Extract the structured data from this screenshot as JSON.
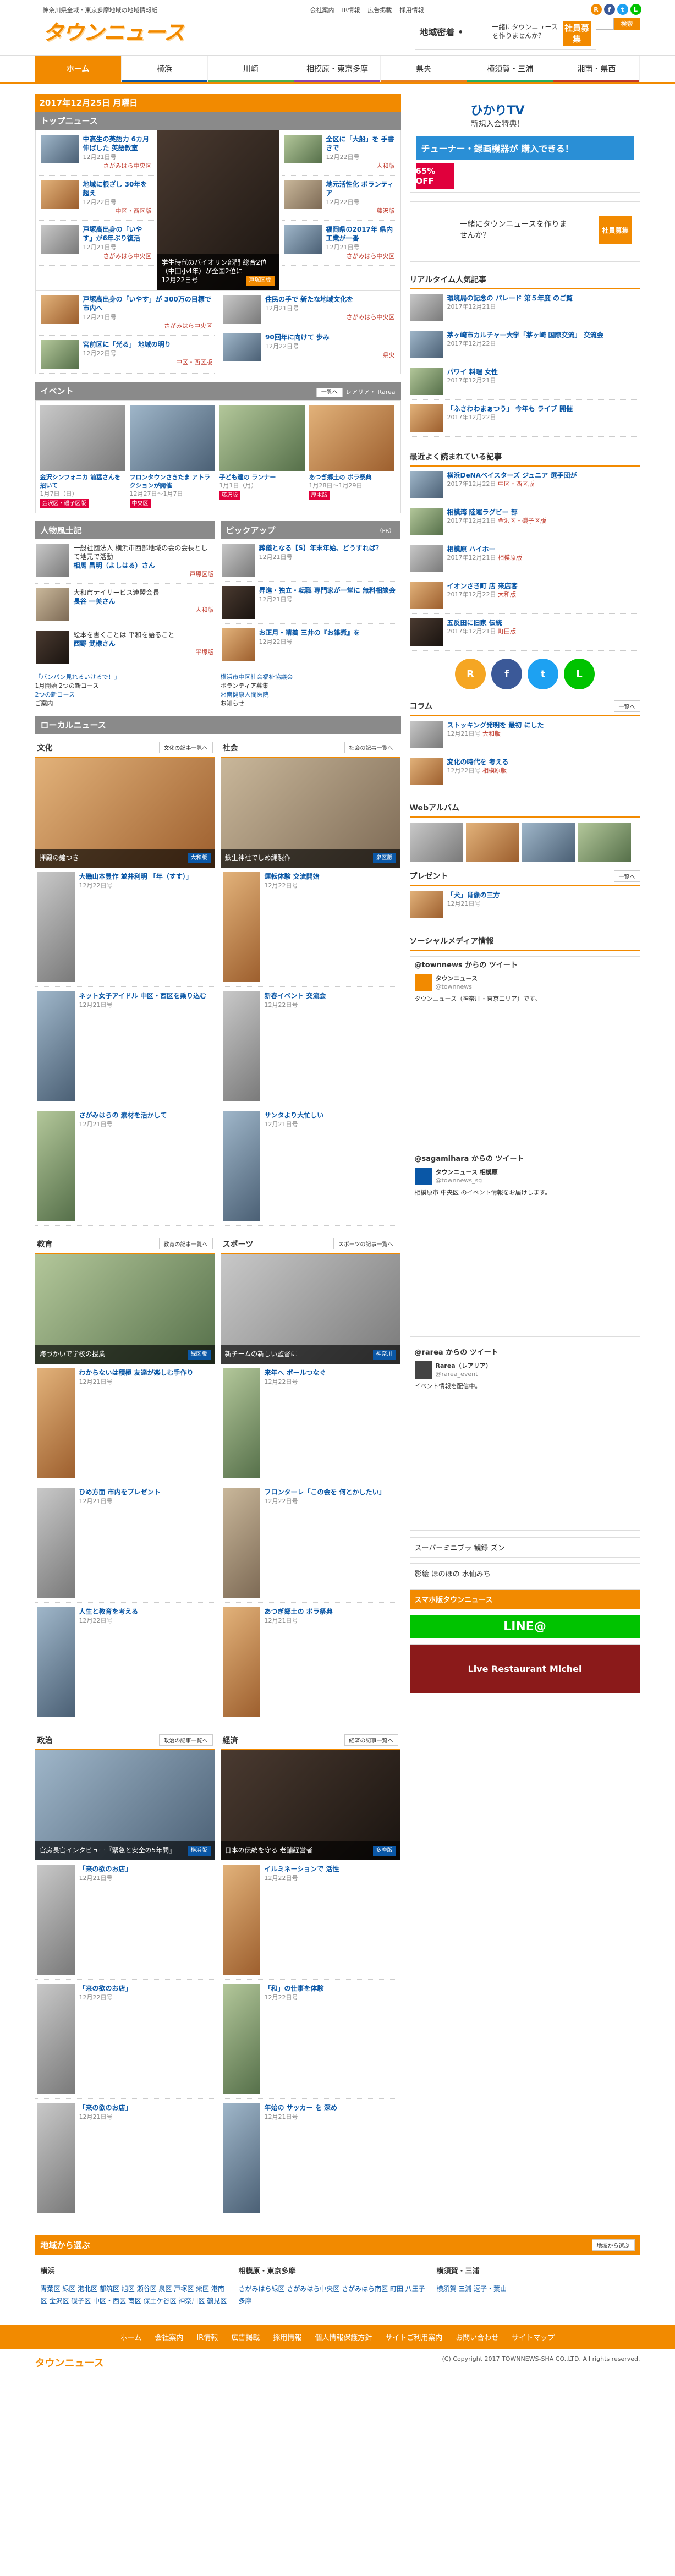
{
  "header": {
    "tagline": "神奈川県全域・東京多摩地域の地域情報紙",
    "logo": "タウンニュース",
    "logo_sub": "タウンニュース",
    "links": [
      "会社案内",
      "IR情報",
      "広告掲載",
      "採用情報"
    ],
    "search_placeholder": "",
    "search_button": "検索",
    "banner_left": "地域密着 •",
    "banner_mid": "一緒にタウンニュースを作りませんか？",
    "banner_right": "社員募集"
  },
  "nav": {
    "items": [
      {
        "label": "ホーム",
        "color": "#f28a00"
      },
      {
        "label": "横浜",
        "color": "#0a57a6"
      },
      {
        "label": "川崎",
        "color": "#4caf50"
      },
      {
        "label": "相模原・東京多摩",
        "color": "#8e44ad"
      },
      {
        "label": "県央",
        "color": "#e67e22"
      },
      {
        "label": "横須賀・三浦",
        "color": "#27ae60"
      },
      {
        "label": "湘南・県西",
        "color": "#c0392b"
      }
    ]
  },
  "datebar": "2017年12月25日 月曜日",
  "top_news": {
    "title": "トップニュース",
    "left": [
      {
        "title": "中高生の英語力 6カ月伸ばした 英語教室",
        "date": "12月21日号",
        "area": "さがみはら中央区"
      },
      {
        "title": "地域に根ざし 30年を超え",
        "date": "12月22日号",
        "area": "中区・西区版"
      },
      {
        "title": "戸塚高出身の「いやす」が6年ぶり復活",
        "date": "12月21日号",
        "area": "さがみはら中央区"
      }
    ],
    "feature": {
      "caption": "学生時代のバイオリン部門 総合2位（中田小4年）が全国2位に",
      "date": "12月22日号",
      "tag": "戸塚区版"
    },
    "right": [
      {
        "title": "全区に「大船」を 手書きで",
        "date": "12月22日号",
        "area": "大和版"
      },
      {
        "title": "地元活性化 ボランティア",
        "date": "12月22日号",
        "area": "藤沢版"
      },
      {
        "title": "福岡県の2017年 県内工業が一番",
        "date": "12月21日号",
        "area": "さがみはら中央区"
      }
    ]
  },
  "grid_news": [
    {
      "title": "戸塚高出身の「いやす」が 300万の目標で 市内へ",
      "date": "12月21日号",
      "area": "さがみはら中央区"
    },
    {
      "title": "宮前区に「光る」 地域の明り",
      "date": "12月22日号",
      "area": "中区・西区版"
    },
    {
      "title": "住民の手で 新たな地域文化を",
      "date": "12月21日号",
      "area": "さがみはら中央区"
    },
    {
      "title": "90回年に向けて 歩み",
      "date": "12月22日号",
      "area": "県央"
    }
  ],
  "events": {
    "title": "イベント",
    "more": "一覧へ",
    "rarea": "レアリア・ Rarea",
    "items": [
      {
        "title": "金沢シンフォニカ 前猛さんを 招いて",
        "date": "1月7日（日）",
        "badge": "金沢区・磯子区版"
      },
      {
        "title": "フロンタウンさきたま アトラクションが開催",
        "date": "12月27日〜1月7日",
        "badge": "中央区"
      },
      {
        "title": "子ども達の ランナー",
        "date": "1月1日（月）",
        "badge": "藤沢版"
      },
      {
        "title": "あつぎ郷土の ポラ祭典",
        "date": "1月28日〜1月29日",
        "badge": "厚木版"
      }
    ]
  },
  "people": {
    "title": "人物風土記",
    "items": [
      {
        "title": "一般社団法人 横浜市西部地域の会の会長として地元で活動",
        "name": "相馬 昌明（よしはる）さん",
        "area": "戸塚区版"
      },
      {
        "title": "大和市テイサービス連盟会長",
        "name": "長谷 一美さん",
        "area": "大和版"
      },
      {
        "title": "絵本を書くことは 平和を語ること",
        "name": "西野 武様さん",
        "area": "平塚版"
      }
    ]
  },
  "pickup": {
    "title": "ピックアップ",
    "pr": "（PR）",
    "items": [
      {
        "title": "葬儀となる【S】年末年始、どうすれば？",
        "date": "12月21日号"
      },
      {
        "title": "昇進・独立・転職 専門家が一堂に 無料相談会",
        "date": "12月21日号"
      },
      {
        "title": "お正月・晴着 三井の『お雑煮』を",
        "date": "12月22日号"
      }
    ]
  },
  "ads_left": [
    {
      "title": "「バンパン見れるいけるで！」",
      "body": "1月開始 2つの新コース"
    },
    {
      "title": "2つの新コース",
      "body": "ご案内"
    }
  ],
  "ads_right": [
    {
      "title": "横浜市中区社会福祉協議会",
      "body": "ボランティア募集"
    },
    {
      "title": "湘南健康人間医院",
      "body": "お知らせ"
    }
  ],
  "local": {
    "title": "ローカルニュース",
    "culture": {
      "title": "文化",
      "more": "文化の記事一覧へ",
      "caption": "拝殿の鐘つき",
      "tag": "大和版"
    },
    "society": {
      "title": "社会",
      "more": "社会の記事一覧へ",
      "caption": "鉄生神社でしめ縄製作",
      "tag": "泉区版"
    },
    "culture_items": [
      {
        "title": "大磯山本豊作 並井利明 「年（すす）」",
        "date": "12月22日号"
      },
      {
        "title": "ネット女子アイドル 中区・西区を乗り込む",
        "date": "12月21日号"
      },
      {
        "title": "さがみはらの 素材を活かして",
        "date": "12月21日号"
      }
    ],
    "society_items": [
      {
        "title": "運転体験 交流開始",
        "date": "12月22日号"
      },
      {
        "title": "新春イベント 交流会",
        "date": "12月22日号"
      },
      {
        "title": "サンタより大忙しい",
        "date": "12月21日号"
      }
    ],
    "education": {
      "title": "教育",
      "more": "教育の記事一覧へ",
      "caption": "海づかいで学校の授業",
      "tag": "緑区版"
    },
    "sports": {
      "title": "スポーツ",
      "more": "スポーツの記事一覧へ",
      "caption": "新チームの新しい監督に",
      "tag": "神奈川"
    },
    "education_items": [
      {
        "title": "わからないは積極 友達が楽しむ手作り",
        "date": "12月21日号"
      },
      {
        "title": "ひめ方面 市内をプレゼント",
        "date": "12月21日号"
      },
      {
        "title": "人生と教育を考える",
        "date": "12月22日号"
      }
    ],
    "sports_items": [
      {
        "title": "来年へ ボールつなぐ",
        "date": "12月22日号"
      },
      {
        "title": "フロンターレ「この会を 何とかしたい」",
        "date": "12月22日号"
      },
      {
        "title": "あつぎ郷土の ポラ祭典",
        "date": "12月21日号"
      }
    ],
    "politics": {
      "title": "政治",
      "more": "政治の記事一覧へ",
      "caption": "官房長官インタビュー『緊急と安全の5年間』",
      "tag": "横浜版"
    },
    "economy": {
      "title": "経済",
      "more": "経済の記事一覧へ",
      "caption": "日本の伝統を守る 老舗経営者",
      "tag": "多摩版"
    },
    "politics_items": [
      {
        "title": "「来の欲のお店」",
        "date": "12月21日号"
      },
      {
        "title": "「来の欲のお店」",
        "date": "12月22日号"
      },
      {
        "title": "「来の欲のお店」",
        "date": "12月21日号"
      }
    ],
    "economy_items": [
      {
        "title": "イルミネーションで 活性",
        "date": "12月22日号"
      },
      {
        "title": "「和」の仕事を体験",
        "date": "12月22日号"
      },
      {
        "title": "年始の サッカー を 深め",
        "date": "12月21日号"
      }
    ]
  },
  "side": {
    "banner1_title": "ひかりTV",
    "banner1_sub": "新規入会特典！",
    "banner1_mid": "チューナー・録画機器が 購入できる！",
    "banner1_off": "65% OFF",
    "banner2_text": "一緒にタウンニュースを作りませんか？",
    "banner2_tag": "社員募集",
    "realarea_title": "リアルタイム人気記事",
    "ranks": [
      {
        "title": "環境局の記念の パレード 第５年度 のご覧",
        "date": "2017年12月21日"
      },
      {
        "title": "茅ヶ崎市カルチャー大学「茅ヶ崎 国際交流」 交流会",
        "date": "2017年12月22日"
      },
      {
        "title": "パワイ 料理 女性",
        "date": "2017年12月21日"
      },
      {
        "title": "「ふさわわまぁつう」 今年も ライブ 開催",
        "date": "2017年12月22日"
      }
    ],
    "recent_title": "最近よく読まれている記事",
    "recent": [
      {
        "title": "横浜DeNAベイスターズ ジュニア 選手団が",
        "date": "2017年12月22日",
        "area": "中区・西区版"
      },
      {
        "title": "相模湾 陸運ラグビー 部",
        "date": "2017年12月21日",
        "area": "金沢区・磯子区版"
      },
      {
        "title": "相模原 ハイホー",
        "date": "2017年12月21日",
        "area": "相模原版"
      },
      {
        "title": "イオンさき町 店 来店客",
        "date": "2017年12月22日",
        "area": "大和版"
      },
      {
        "title": "五反田に旧家 伝統",
        "date": "2017年12月21日",
        "area": "町田版"
      }
    ],
    "column_title": "コラム",
    "column_more": "一覧へ",
    "columns": [
      {
        "title": "ストッキング発明を 最初 にした",
        "date": "12月21日号",
        "area": "大和版"
      },
      {
        "title": "変化の時代を 考える",
        "date": "12月22日号",
        "area": "相模原版"
      }
    ],
    "web_album_title": "Webアルバム",
    "present_title": "プレゼント",
    "present_more": "一覧へ",
    "present_item": {
      "title": "「犬」肖像の三方",
      "date": "12月21日号"
    },
    "social_title": "ソーシャルメディア情報",
    "tweets": [
      {
        "head": "@townnews からの ツイート",
        "user": "タウンニュース",
        "handle": "@townnews",
        "body": "タウンニュース（神奈川・東京エリア）です。"
      },
      {
        "head": "@sagamihara からの ツイート",
        "user": "タウンニュース 相模原",
        "handle": "@townnews_sg",
        "body": "相模原市 中央区 のイベント情報をお届けします。"
      },
      {
        "head": "@rarea からの ツイート",
        "user": "Rarea（レアリア）",
        "handle": "@rarea_event",
        "body": "イベント情報を配信中。"
      }
    ],
    "side_ad1": "スーパーミニブラ 観録 ズン",
    "side_ad2": "影絵 ほのほの 水仙みち",
    "smartphone": "スマホ版タウンニュース",
    "line_label": "LINE@",
    "restaurant": "Live Restaurant Michel"
  },
  "footer": {
    "area_title": "地域から選ぶ",
    "area_more": "地域から選ぶ",
    "cols": [
      {
        "name": "横浜",
        "links": "青葉区 緑区 港北区 都筑区 旭区 瀬谷区 泉区 戸塚区 栄区 港南区 金沢区 磯子区 中区・西区 南区 保土ケ谷区 神奈川区 鶴見区"
      },
      {
        "name": "相模原・東京多摩",
        "links": "さがみはら緑区 さがみはら中央区 さがみはら南区 町田 八王子 多摩"
      },
      {
        "name": "横須賀・三浦",
        "links": "横須賀 三浦 逗子・葉山"
      }
    ],
    "nav": [
      "ホーム",
      "会社案内",
      "IR情報",
      "広告掲載",
      "採用情報",
      "個人情報保護方針",
      "サイトご利用案内",
      "お問い合わせ",
      "サイトマップ"
    ],
    "copyright": "(C) Copyright 2017 TOWNNEWS-SHA CO.,LTD. All rights reserved."
  }
}
